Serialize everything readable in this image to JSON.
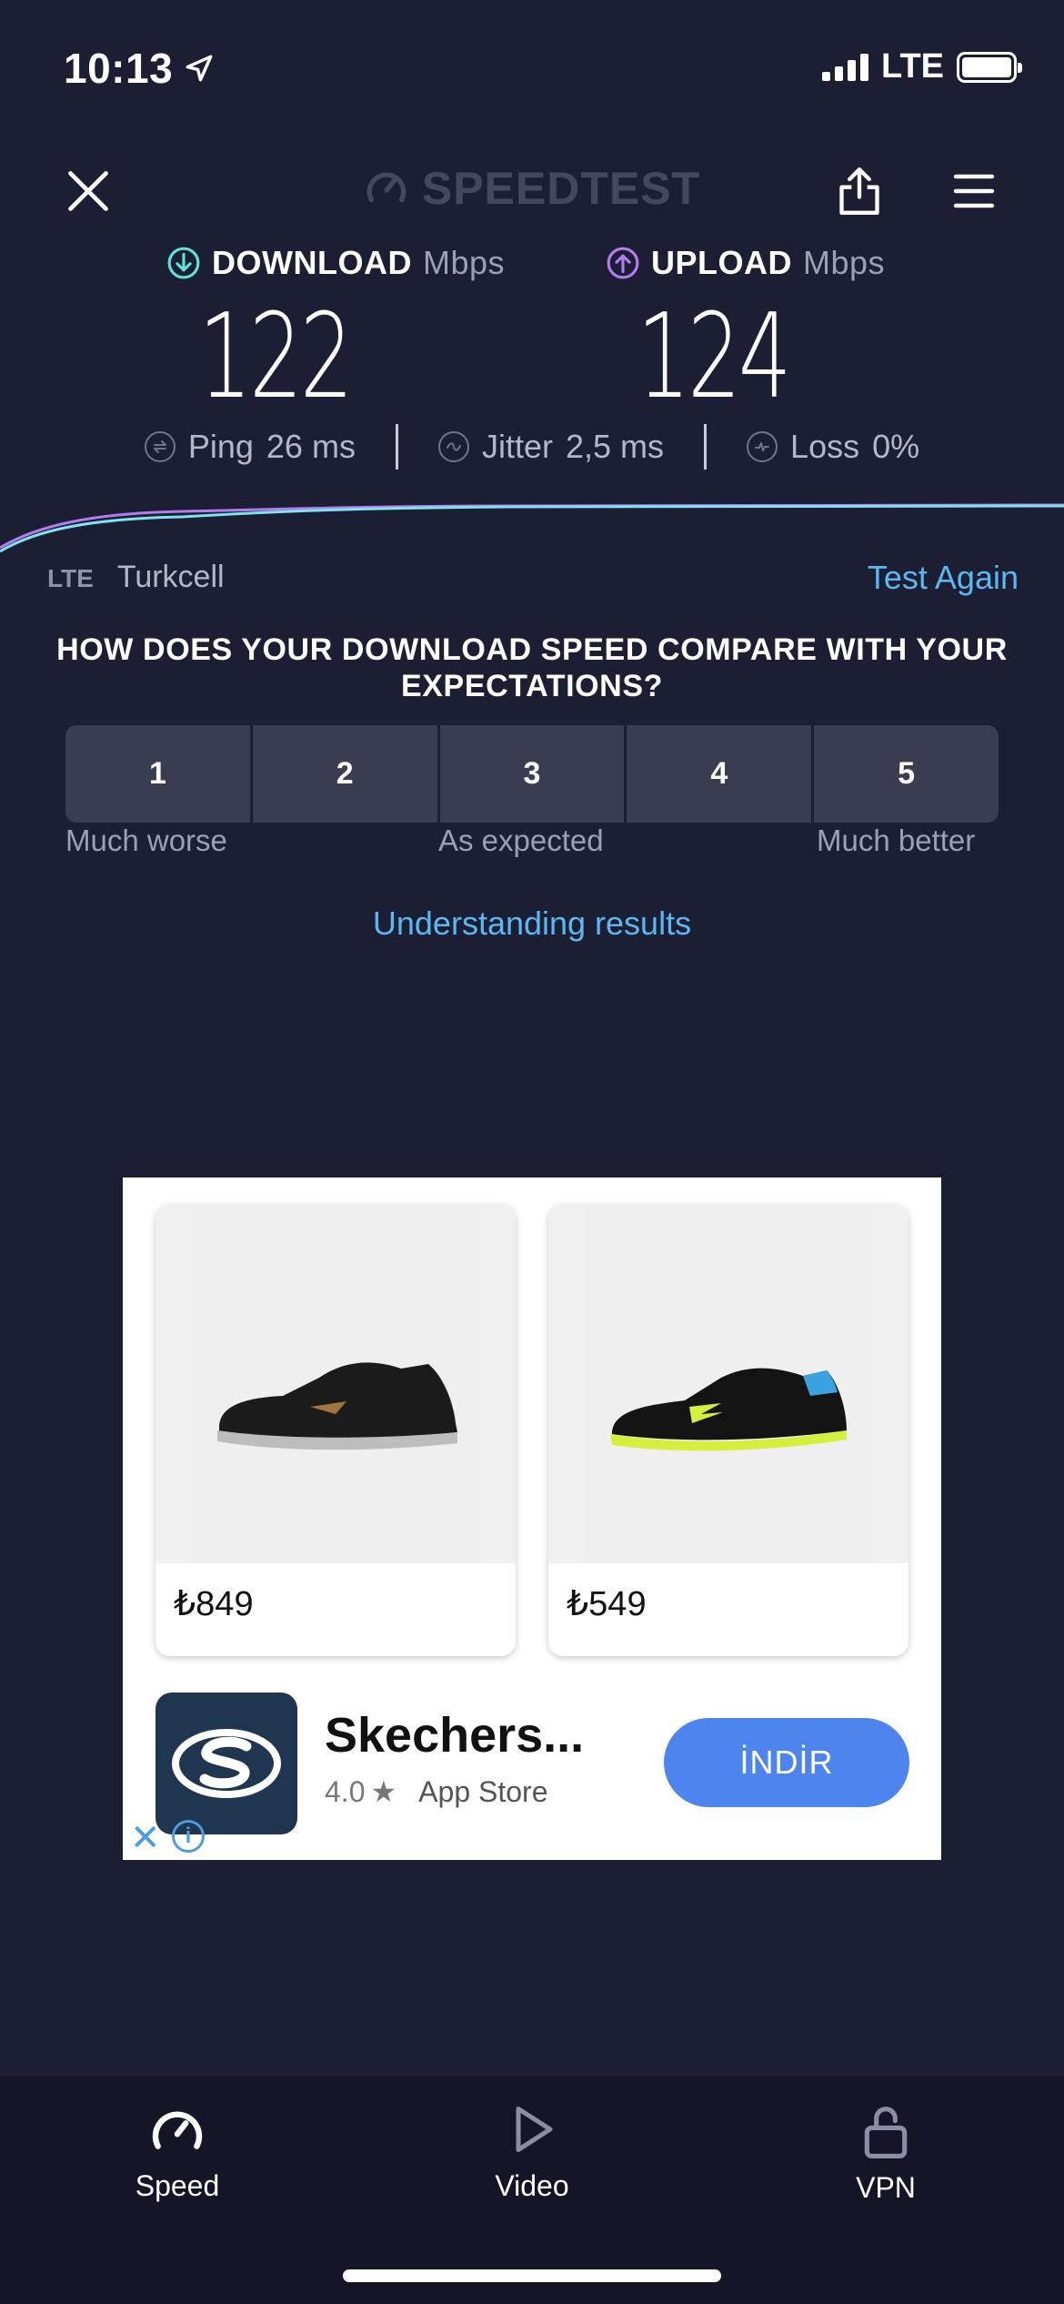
{
  "status": {
    "time": "10:13",
    "network": "LTE"
  },
  "header": {
    "brand": "SPEEDTEST"
  },
  "download": {
    "label": "DOWNLOAD",
    "unit": "Mbps",
    "value": "122",
    "color": "#5ee1d6"
  },
  "upload": {
    "label": "UPLOAD",
    "unit": "Mbps",
    "value": "124",
    "color": "#b57cf0"
  },
  "stats": {
    "ping_label": "Ping",
    "ping_value": "26",
    "ping_unit": "ms",
    "jitter_label": "Jitter",
    "jitter_value": "2,5",
    "jitter_unit": "ms",
    "loss_label": "Loss",
    "loss_value": "0",
    "loss_unit": "%"
  },
  "connection": {
    "type": "LTE",
    "carrier": "Turkcell",
    "test_again": "Test Again"
  },
  "survey": {
    "question": "HOW DOES YOUR DOWNLOAD SPEED COMPARE WITH YOUR EXPECTATIONS?",
    "options": [
      "1",
      "2",
      "3",
      "4",
      "5"
    ],
    "low_label": "Much worse",
    "mid_label": "As expected",
    "high_label": "Much better"
  },
  "understanding_link": "Understanding results",
  "ad": {
    "products": [
      {
        "price": "₺849"
      },
      {
        "price": "₺549"
      }
    ],
    "app_name": "Skechers...",
    "rating": "4.0",
    "store": "App Store",
    "cta": "İNDİR"
  },
  "tabs": [
    {
      "label": "Speed",
      "icon": "speedometer-icon"
    },
    {
      "label": "Video",
      "icon": "play-icon"
    },
    {
      "label": "VPN",
      "icon": "lock-icon"
    }
  ]
}
